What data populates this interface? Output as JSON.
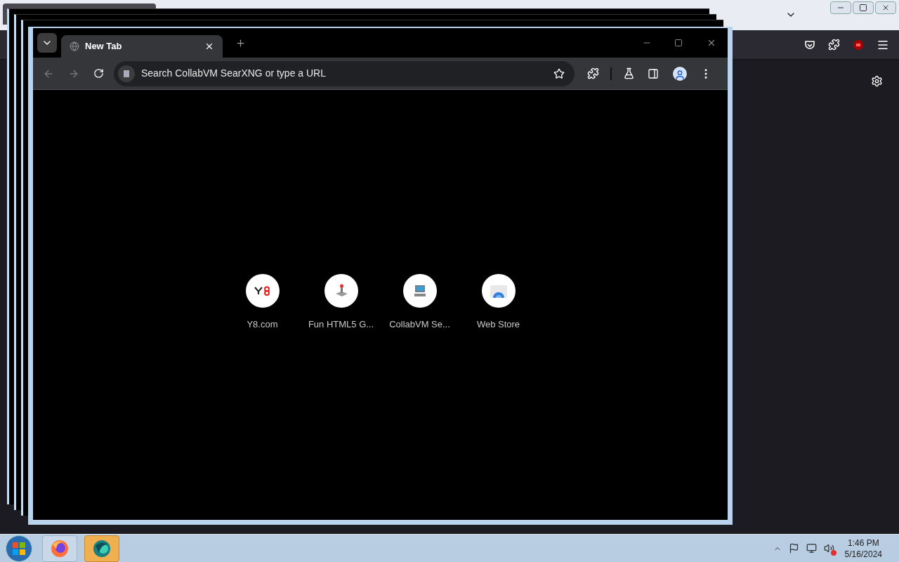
{
  "chrome": {
    "tabs": [
      {
        "title": "New Tab",
        "selected": true
      }
    ],
    "omnibox": {
      "placeholder": "Search CollabVM SearXNG or type a URL"
    },
    "shortcuts": [
      {
        "label": "Y8.com",
        "kind": "y8"
      },
      {
        "label": "Fun HTML5 G...",
        "kind": "joystick"
      },
      {
        "label": "CollabVM Se...",
        "kind": "computer"
      },
      {
        "label": "Web Store",
        "kind": "store"
      }
    ]
  },
  "taskbar": {
    "time": "1:46 PM",
    "date": "5/16/2024"
  }
}
